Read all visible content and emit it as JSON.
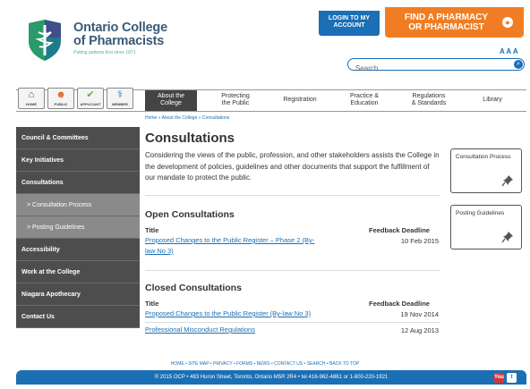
{
  "brand": {
    "name_line1": "Ontario College",
    "name_line2": "of Pharmacists",
    "tagline": "Putting patients first since 1871"
  },
  "header": {
    "login": "LOGIN TO MY ACCOUNT",
    "find_line1": "FIND A PHARMACY",
    "find_line2": "OR PHARMACIST",
    "font_size_control": "A A A",
    "search_placeholder": "Search"
  },
  "audience": [
    {
      "label": "HOME",
      "icon": "home-icon"
    },
    {
      "label": "PUBLIC",
      "icon": "people-icon"
    },
    {
      "label": "APPLICANT",
      "icon": "check-icon"
    },
    {
      "label": "MEMBER",
      "icon": "pharmacist-icon"
    }
  ],
  "nav": [
    {
      "line1": "About the",
      "line2": "College"
    },
    {
      "line1": "Protecting",
      "line2": "the Public"
    },
    {
      "line1": "Registration",
      "line2": ""
    },
    {
      "line1": "Practice &",
      "line2": "Education"
    },
    {
      "line1": "Regulations",
      "line2": "& Standards"
    },
    {
      "line1": "Library",
      "line2": ""
    }
  ],
  "breadcrumb": "Home » About the College » Consultations",
  "sidebar": [
    "Council & Committees",
    "Key Initiatives",
    "Consultations",
    "> Consultation Process",
    "> Posting Guidelines",
    "Accessibility",
    "Work at the College",
    "Niagara Apothecary",
    "Contact Us"
  ],
  "main": {
    "title": "Consultations",
    "intro": "Considering the views of the public, profession, and other stakeholders assists the College in the development of policies, guidelines and other documents that support the fulfillment of our mandate to protect the public.",
    "open": {
      "heading": "Open Consultations",
      "col_title": "Title",
      "col_deadline": "Feedback Deadline",
      "rows": [
        {
          "title_line1": "Proposed Changes to the Public Register – Phase 2 (By-",
          "title_line2": "law No 3)",
          "deadline": "10 Feb 2015"
        }
      ]
    },
    "closed": {
      "heading": "Closed Consultations",
      "col_title": "Title",
      "col_deadline": "Feedback Deadline",
      "rows": [
        {
          "title": "Proposed Changes to the Public Register (By-law No 3)",
          "deadline": "19 Nov 2014"
        },
        {
          "title": "Professional Misconduct Regulations",
          "deadline": "12 Aug 2013"
        }
      ]
    }
  },
  "cards": [
    {
      "title": "Consultation Process"
    },
    {
      "title": "Posting Guidelines"
    }
  ],
  "footer": {
    "links": "HOME • SITE MAP • PRIVACY • FORMS • NEWS • CONTACT US • SEARCH • BACK TO TOP",
    "copyright": "© 2015 OCP • 483 Huron Street, Toronto, Ontario M5R 2R4 • tel 416-962-4861 or 1-800-220-1921",
    "youtube": "You",
    "twitter": "t"
  },
  "colors": {
    "brand_blue": "#1a6fb5",
    "accent_orange": "#f07d23",
    "sidebar_dark": "#4d4d4d"
  }
}
